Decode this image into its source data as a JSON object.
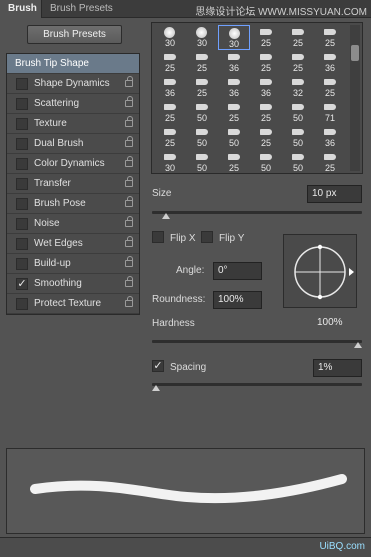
{
  "tabs": {
    "brush": "Brush",
    "brush_presets": "Brush Presets"
  },
  "watermark": "思缘设计论坛 WWW.MISSYUAN.COM",
  "left_panel": {
    "presets_button": "Brush Presets",
    "selected_item": "Brush Tip Shape",
    "items": [
      {
        "label": "Shape Dynamics",
        "checked": false
      },
      {
        "label": "Scattering",
        "checked": false
      },
      {
        "label": "Texture",
        "checked": false
      },
      {
        "label": "Dual Brush",
        "checked": false
      },
      {
        "label": "Color Dynamics",
        "checked": false
      },
      {
        "label": "Transfer",
        "checked": false
      },
      {
        "label": "Brush Pose",
        "checked": false
      },
      {
        "label": "Noise",
        "checked": false
      },
      {
        "label": "Wet Edges",
        "checked": false
      },
      {
        "label": "Build-up",
        "checked": false
      },
      {
        "label": "Smoothing",
        "checked": true
      },
      {
        "label": "Protect Texture",
        "checked": false
      }
    ]
  },
  "brush_grid": {
    "rows": [
      [
        "30",
        "30",
        "30",
        "25",
        "25",
        "25"
      ],
      [
        "25",
        "25",
        "36",
        "25",
        "25",
        "36"
      ],
      [
        "36",
        "25",
        "36",
        "36",
        "32",
        "25"
      ],
      [
        "25",
        "50",
        "25",
        "25",
        "50",
        "71"
      ],
      [
        "25",
        "50",
        "50",
        "25",
        "50",
        "36"
      ],
      [
        "30",
        "50",
        "25",
        "50",
        "50",
        "25"
      ]
    ],
    "selected_index": 2
  },
  "settings": {
    "size_label": "Size",
    "size_value": "10 px",
    "size_slider": 0.05,
    "flip_x": "Flip X",
    "flip_y": "Flip Y",
    "angle_label": "Angle:",
    "angle_value": "0°",
    "roundness_label": "Roundness:",
    "roundness_value": "100%",
    "hardness_label": "Hardness",
    "hardness_value": "100%",
    "hardness_slider": 1.0,
    "spacing_label": "Spacing",
    "spacing_checked": true,
    "spacing_value": "1%",
    "spacing_slider": 0.0
  },
  "footer_mark": "UiBQ.com"
}
